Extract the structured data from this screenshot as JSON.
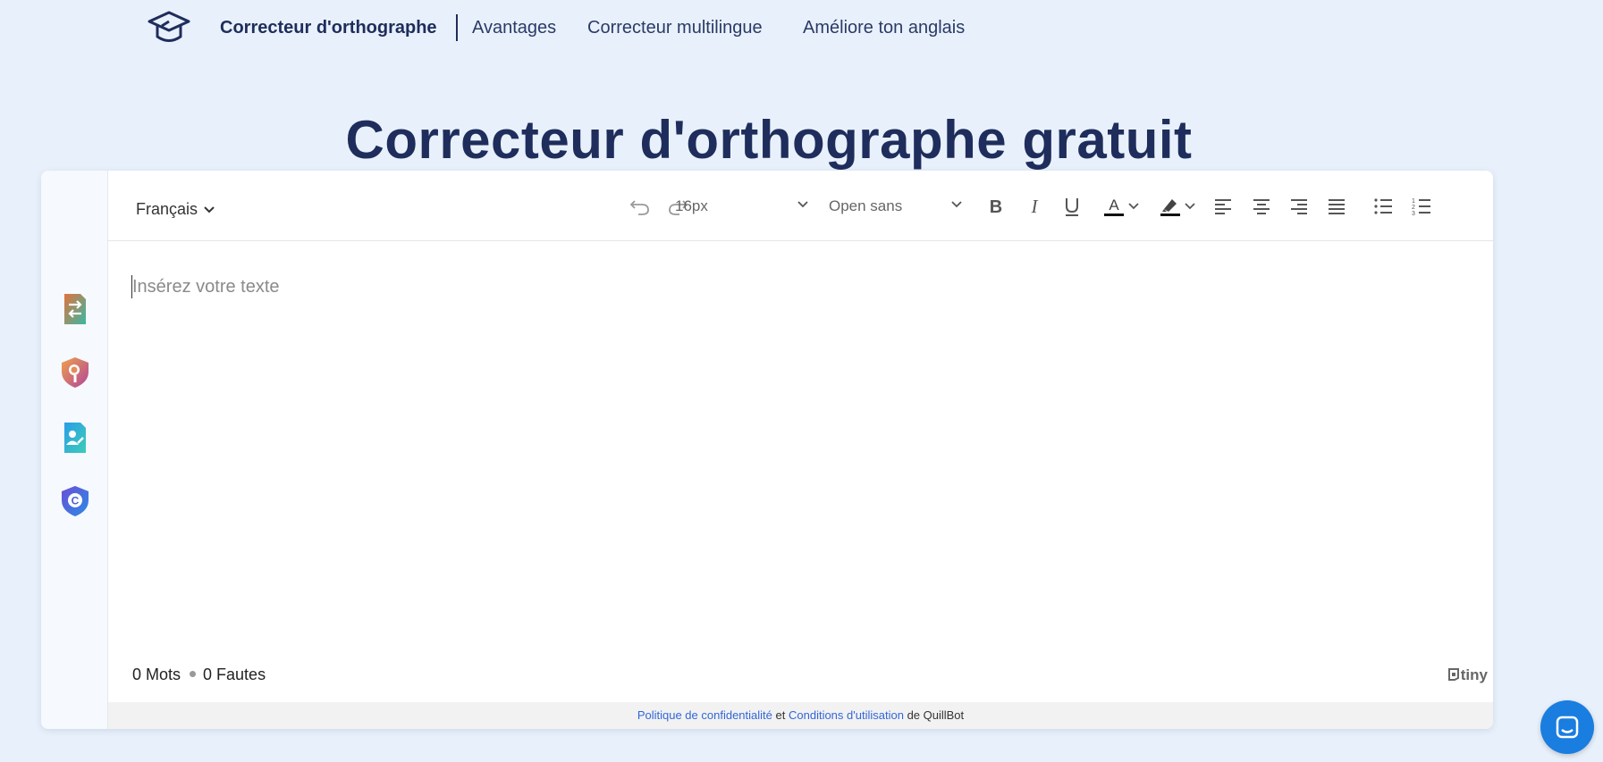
{
  "nav": {
    "brand": "Correcteur d'orthographe",
    "links": [
      "Avantages",
      "Correcteur multilingue",
      "Améliore ton anglais"
    ]
  },
  "page_title": "Correcteur d'orthographe gratuit",
  "sidebar": {
    "icons": [
      "paraphraser-icon",
      "plagiarism-checker-icon",
      "ai-detector-icon",
      "citation-generator-icon"
    ]
  },
  "toolbar": {
    "language": "Français",
    "font_size": "16px",
    "font_family": "Open sans"
  },
  "editor": {
    "placeholder": "Insérez votre texte"
  },
  "stats": {
    "words": "0 Mots",
    "errors": "0 Fautes"
  },
  "branding": "tiny",
  "footer": {
    "privacy": "Politique de confidentialité",
    "and": "et",
    "terms": "Conditions d'utilisation",
    "suffix": "de QuillBot"
  },
  "colors": {
    "background": "#e8f1fb",
    "heading": "#1f2d5c",
    "link": "#3367d6",
    "chat": "#1a7de0"
  }
}
